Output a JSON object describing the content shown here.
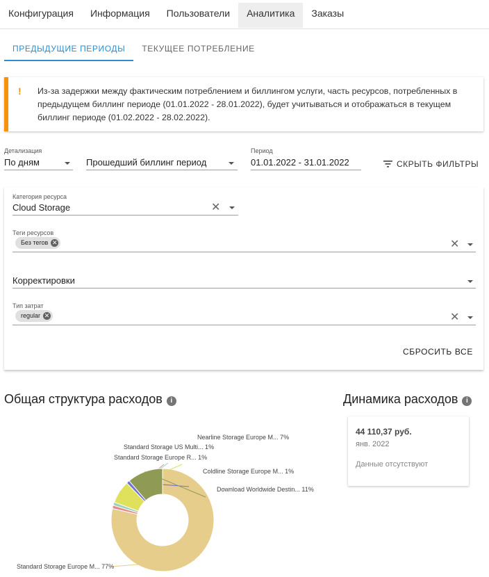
{
  "nav": {
    "items": [
      {
        "label": "Конфигурация"
      },
      {
        "label": "Информация"
      },
      {
        "label": "Пользователи"
      },
      {
        "label": "Аналитика"
      },
      {
        "label": "Заказы"
      }
    ],
    "active_index": 3
  },
  "subtabs": {
    "items": [
      {
        "label": "Предыдущие периоды"
      },
      {
        "label": "Текущее потребление"
      }
    ],
    "active_index": 0
  },
  "warning": {
    "mark": "!",
    "text": "Из-за задержки между фактическим потреблением и биллингом услуги, часть ресурсов, потребленных в предыдущем биллинг периоде (01.01.2022 - 28.01.2022), будет учитываться и отображаться в текущем биллинг периоде (01.02.2022 - 28.02.2022).",
    "accent": "#f5930e"
  },
  "filters": {
    "detail": {
      "label": "Детализация",
      "value": "По дням"
    },
    "billing": {
      "value": "Прошедший биллинг период"
    },
    "period": {
      "label": "Период",
      "value": "01.01.2022 - 31.01.2022"
    },
    "hide_label": "Скрыть фильтры"
  },
  "panel": {
    "category": {
      "label": "Категория ресурса",
      "value": "Cloud Storage"
    },
    "tags": {
      "label": "Теги ресурсов",
      "chip": "Без тегов"
    },
    "corrections": {
      "placeholder": "Корректировки"
    },
    "cost_type": {
      "label": "Тип затрат",
      "chip": "regular"
    },
    "reset_label": "Сбросить все"
  },
  "structure": {
    "title": "Общая структура расходов"
  },
  "dynamics": {
    "title": "Динамика расходов",
    "amount": "44 110,37 руб.",
    "period": "янв. 2022",
    "no_data": "Данные отсутствуют"
  },
  "chart_data": {
    "type": "pie",
    "donut": true,
    "series": [
      {
        "name": "Standard Storage Europe M...",
        "value": 77,
        "label": "Standard Storage Europe M... 77%",
        "color": "#e6cd8c"
      },
      {
        "name": "Standard Storage Europe R...",
        "value": 1,
        "label": "Standard Storage Europe R... 1%",
        "color": "#e78a8a"
      },
      {
        "name": "Standard Storage US Multi...",
        "value": 1,
        "label": "Standard Storage US Multi... 1%",
        "color": "#9fd3b5"
      },
      {
        "name": "Nearline Storage Europe M...",
        "value": 7,
        "label": "Nearline Storage Europe M... 7%",
        "color": "#dfe05c"
      },
      {
        "name": "Coldline Storage Europe M...",
        "value": 1,
        "label": "Coldline Storage Europe M... 1%",
        "color": "#6f73d6"
      },
      {
        "name": "Download Worldwide Destin...",
        "value": 11,
        "label": "Download Worldwide Destin... 11%",
        "color": "#8f9a55"
      }
    ]
  }
}
